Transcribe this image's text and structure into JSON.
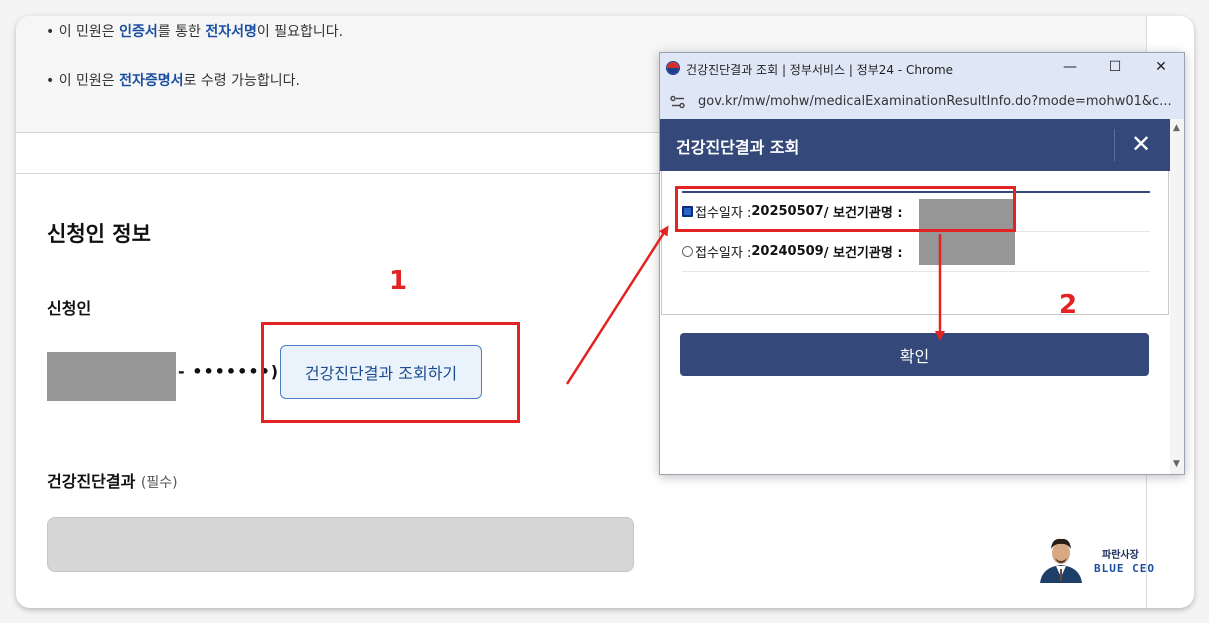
{
  "notice": {
    "line1": {
      "bullet": "•",
      "p1": "이 민원은 ",
      "b1": "인증서",
      "p2": "를 통한 ",
      "b2": "전자서명",
      "p3": "이 필요합니다."
    },
    "line2": {
      "bullet": "•",
      "p1": "이 민원은 ",
      "b1": "전자증명서",
      "p2": "로 수령 가능합니다."
    }
  },
  "applicant_section": {
    "title": "신청인 정보",
    "applicant_label": "신청인",
    "id_suffix": "- •••••••)",
    "query_button": "건강진단결과 조회하기",
    "result_label": "건강진단결과",
    "result_required": "(필수)"
  },
  "annotations": {
    "step1": "1",
    "step2": "2"
  },
  "popup": {
    "window_title": "건강진단결과 조회 | 정부서비스 | 정부24 - Chrome",
    "url": "gov.kr/mw/mohw/medicalExaminationResultInfo.do?mode=mohw01&c...",
    "header_title": "건강진단결과 조회",
    "close_symbol": "✕",
    "options": [
      {
        "prefix": "접수일자 : ",
        "date": "20250507",
        "mid": " / 보건기관명 : ",
        "selected": true
      },
      {
        "prefix": "접수일자 : ",
        "date": "20240509",
        "mid": " / 보건기관명 : ",
        "selected": false
      }
    ],
    "confirm_button": "확인",
    "minimize": "—",
    "maximize": "☐",
    "close_window": "✕"
  },
  "logo": {
    "name_ko": "파란사장",
    "name_en": "BLUE CEO"
  },
  "colors": {
    "accent": "#34497a",
    "link": "#1a4fa0",
    "annotation": "#e32222"
  }
}
